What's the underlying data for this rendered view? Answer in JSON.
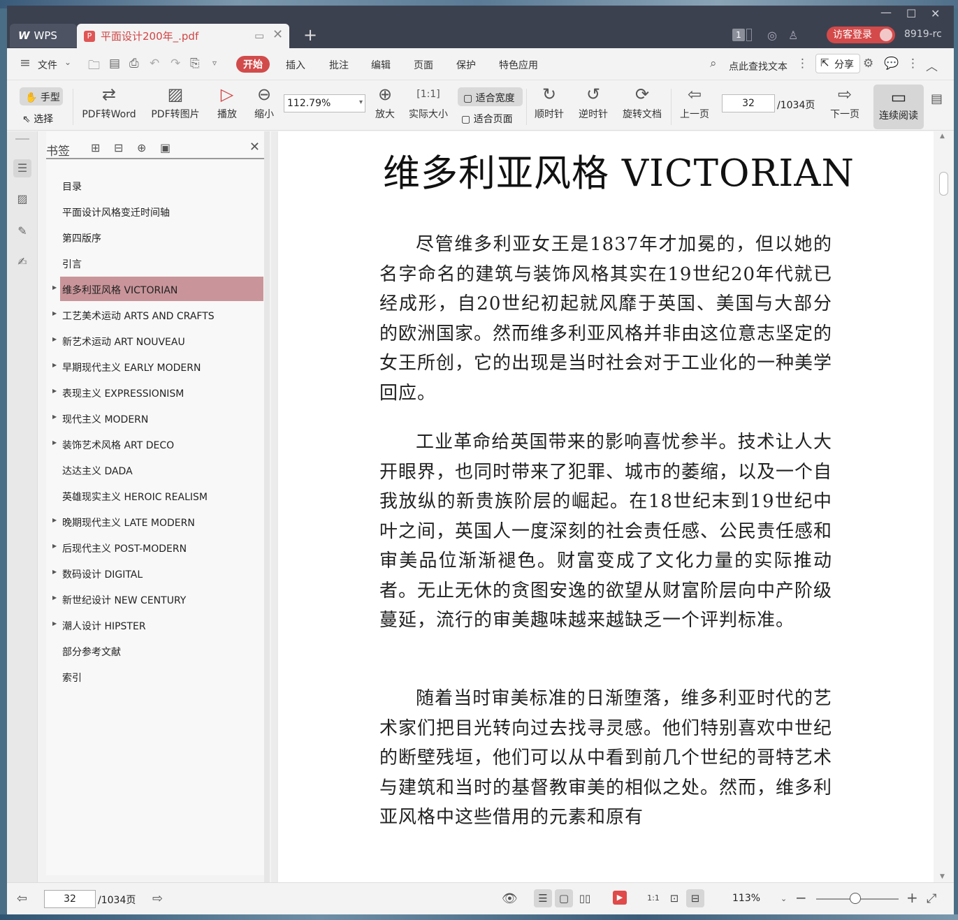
{
  "app": {
    "name": "WPS",
    "doc_tab": "平面设计200年_.pdf",
    "user_label": "8919-rc",
    "login_label": "访客登录",
    "page_badge": "1"
  },
  "menu": {
    "file": "文件",
    "tabs": [
      "开始",
      "插入",
      "批注",
      "编辑",
      "页面",
      "保护",
      "特色应用"
    ],
    "search_placeholder": "点此查找文本",
    "share": "分享"
  },
  "toolbar": {
    "hand": "手型",
    "select": "选择",
    "pdf2word": "PDF转Word",
    "pdf2img": "PDF转图片",
    "play": "播放",
    "zoom_out": "缩小",
    "zoom_value": "112.79%",
    "zoom_in": "放大",
    "actual_size": "实际大小",
    "fit_width": "适合宽度",
    "fit_page": "适合页面",
    "cw": "顺时针",
    "ccw": "逆时针",
    "rotate": "旋转文档",
    "prev": "上一页",
    "page_current": "32",
    "page_total": "/1034页",
    "next": "下一页",
    "continuous": "连续阅读"
  },
  "bookmarks": {
    "title": "书签",
    "items": [
      {
        "label": "目录",
        "expandable": false
      },
      {
        "label": "平面设计风格变迁时间轴",
        "expandable": false
      },
      {
        "label": "第四版序",
        "expandable": false
      },
      {
        "label": "引言",
        "expandable": false
      },
      {
        "label": "维多利亚风格 VICTORIAN",
        "expandable": true,
        "selected": true
      },
      {
        "label": "工艺美术运动 ARTS AND CRAFTS",
        "expandable": true
      },
      {
        "label": "新艺术运动 ART NOUVEAU",
        "expandable": true
      },
      {
        "label": "早期现代主义 EARLY MODERN",
        "expandable": true
      },
      {
        "label": "表现主义 EXPRESSIONISM",
        "expandable": true
      },
      {
        "label": "现代主义 MODERN",
        "expandable": true
      },
      {
        "label": "装饰艺术风格 ART DECO",
        "expandable": true
      },
      {
        "label": "达达主义 DADA",
        "expandable": false
      },
      {
        "label": "英雄现实主义 HEROIC REALISM",
        "expandable": false
      },
      {
        "label": "晚期现代主义 LATE MODERN",
        "expandable": true
      },
      {
        "label": "后现代主义 POST-MODERN",
        "expandable": true
      },
      {
        "label": "数码设计 DIGITAL",
        "expandable": true
      },
      {
        "label": "新世纪设计 NEW CENTURY",
        "expandable": true
      },
      {
        "label": "潮人设计 HIPSTER",
        "expandable": true
      },
      {
        "label": "部分参考文献",
        "expandable": false
      },
      {
        "label": "索引",
        "expandable": false
      }
    ]
  },
  "document": {
    "title": "维多利亚风格 VICTORIAN",
    "paragraphs": [
      "尽管维多利亚女王是1837年才加冕的，但以她的名字命名的建筑与装饰风格其实在19世纪20年代就已经成形，自20世纪初起就风靡于英国、美国与大部分的欧洲国家。然而维多利亚风格并非由这位意志坚定的女王所创，它的出现是当时社会对于工业化的一种美学回应。",
      "工业革命给英国带来的影响喜忧参半。技术让人大开眼界，也同时带来了犯罪、城市的萎缩，以及一个自我放纵的新贵族阶层的崛起。在18世纪末到19世纪中叶之间，英国人一度深刻的社会责任感、公民责任感和审美品位渐渐褪色。财富变成了文化力量的实际推动者。无止无休的贪图安逸的欲望从财富阶层向中产阶级蔓延，流行的审美趣味越来越缺乏一个评判标准。",
      "随着当时审美标准的日渐堕落，维多利亚时代的艺术家们把目光转向过去找寻灵感。他们特别喜欢中世纪的断壁残垣，他们可以从中看到前几个世纪的哥特艺术与建筑和当时的基督教审美的相似之处。然而，维多利亚风格中这些借用的元素和原有"
    ]
  },
  "status": {
    "page_current": "32",
    "page_total": "/1034页",
    "zoom": "113%"
  }
}
